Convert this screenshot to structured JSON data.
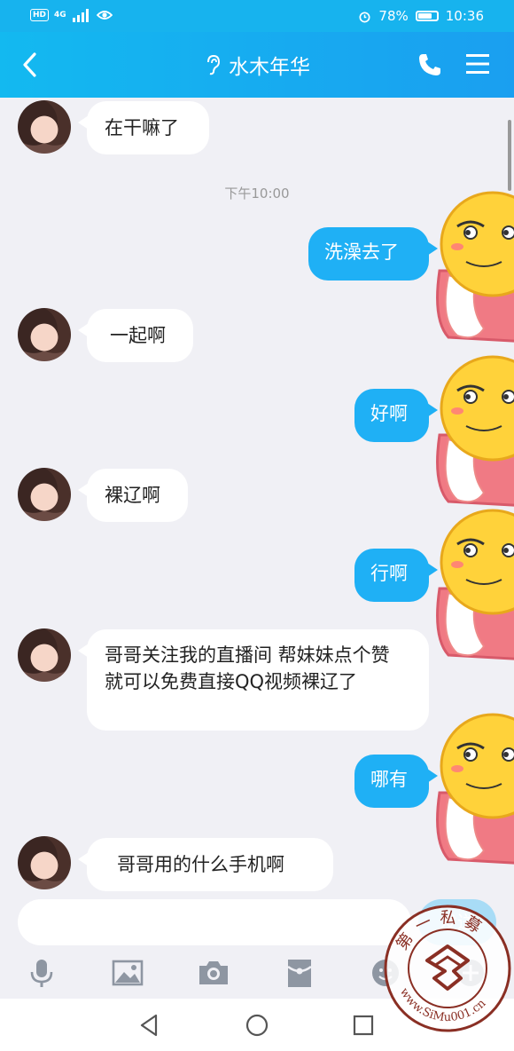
{
  "status_bar": {
    "left_tags": [
      "HD",
      "4G"
    ],
    "battery": "78%",
    "battery_level": 0.78,
    "time": "10:36"
  },
  "header": {
    "title": "水木年华",
    "icons": [
      "back-icon",
      "ear-icon",
      "phone-icon",
      "menu-icon"
    ]
  },
  "chat": {
    "timestamp": "下午10:00",
    "messages": [
      {
        "from": "contact",
        "text": "在干嘛了"
      },
      {
        "from": "me",
        "text": "洗澡去了"
      },
      {
        "from": "contact",
        "text": "一起啊"
      },
      {
        "from": "me",
        "text": "好啊"
      },
      {
        "from": "contact",
        "text": "裸辽啊"
      },
      {
        "from": "me",
        "text": "行啊"
      },
      {
        "from": "contact",
        "text": "哥哥关注我的直播间  帮妹妹点个赞   就可以免费直接QQ视频裸辽了"
      },
      {
        "from": "me",
        "text": "哪有"
      },
      {
        "from": "contact",
        "text": "哥哥用的什么手机啊"
      }
    ]
  },
  "input_bar": {
    "placeholder": "",
    "send_label": "发送",
    "tools": [
      "microphone-icon",
      "image-icon",
      "camera-icon",
      "red-packet-icon",
      "emoji-icon",
      "plus-icon"
    ]
  },
  "watermark": {
    "top_text": "第一私募",
    "url": "www.SiMu001.cn"
  },
  "colors": {
    "accent": "#17b3ee",
    "bubble_out": "#1fb0f5",
    "bubble_in": "#ffffff",
    "background": "#f0f0f5"
  }
}
